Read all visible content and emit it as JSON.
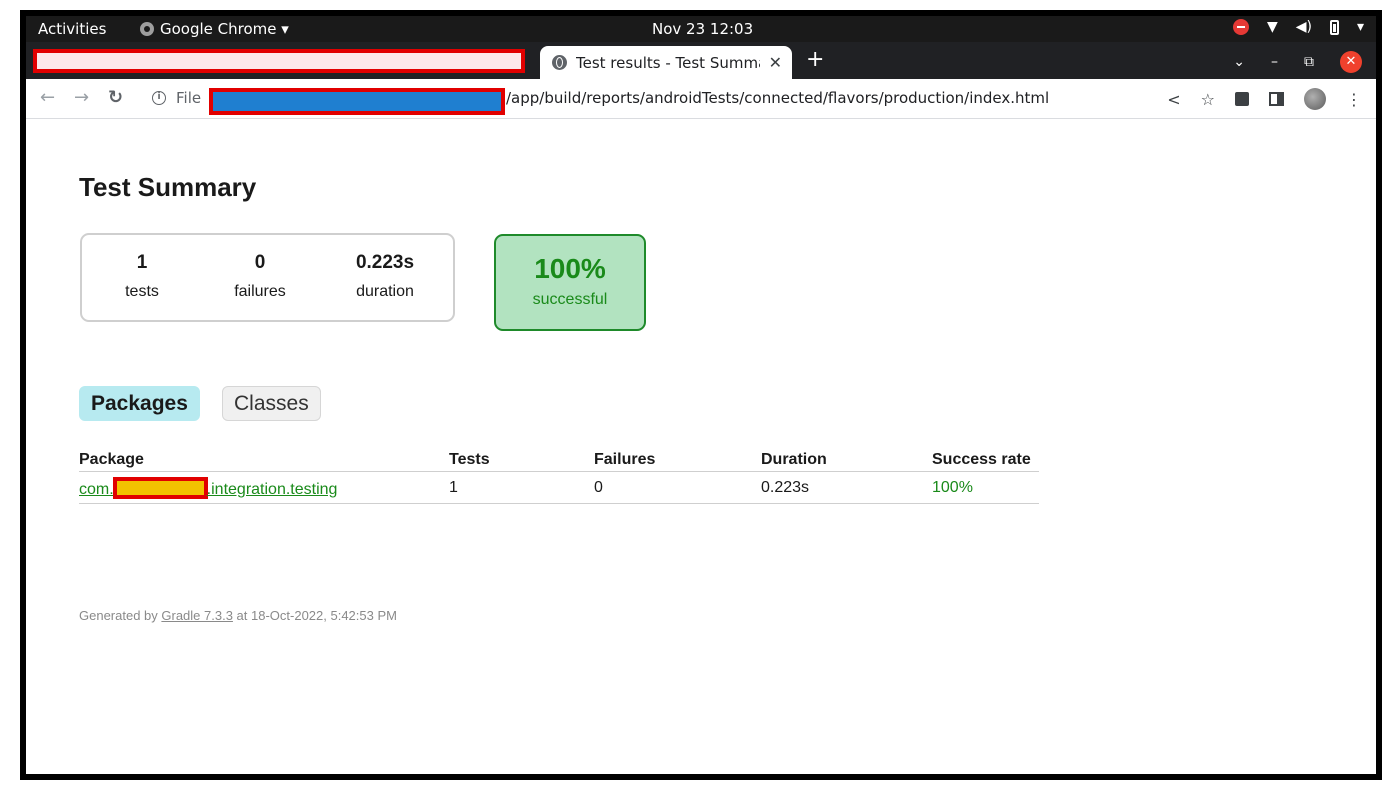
{
  "system_bar": {
    "activities": "Activities",
    "app_name": "Google Chrome ▾",
    "clock": "Nov 23  12:03"
  },
  "browser": {
    "active_tab_title": "Test results - Test Summary",
    "tab_close": "✕",
    "new_tab": "+",
    "file_label": "File",
    "url_visible_part": "/app/build/reports/androidTests/connected/flavors/production/index.html"
  },
  "page": {
    "title": "Test Summary",
    "stats": {
      "tests_value": "1",
      "tests_label": "tests",
      "failures_value": "0",
      "failures_label": "failures",
      "duration_value": "0.223s",
      "duration_label": "duration"
    },
    "success": {
      "value": "100%",
      "label": "successful"
    },
    "tabs": {
      "packages": "Packages",
      "classes": "Classes"
    },
    "table": {
      "headers": {
        "package": "Package",
        "tests": "Tests",
        "failures": "Failures",
        "duration": "Duration",
        "success_rate": "Success rate"
      },
      "rows": [
        {
          "package_prefix": "com.",
          "package_suffix": ".integration.testing",
          "tests": "1",
          "failures": "0",
          "duration": "0.223s",
          "success_rate": "100%"
        }
      ]
    },
    "footer": {
      "prefix": "Generated by ",
      "gradle_link": "Gradle 7.3.3",
      "suffix": " at 18-Oct-2022, 5:42:53 PM"
    }
  },
  "colors": {
    "success_green": "#1a8a1a",
    "success_bg": "#b2e3c0",
    "packages_tab_bg": "#b7eaf0",
    "redaction_red": "#e10000",
    "redaction_blue": "#1f7fd0",
    "redaction_yellow": "#f2c200"
  }
}
